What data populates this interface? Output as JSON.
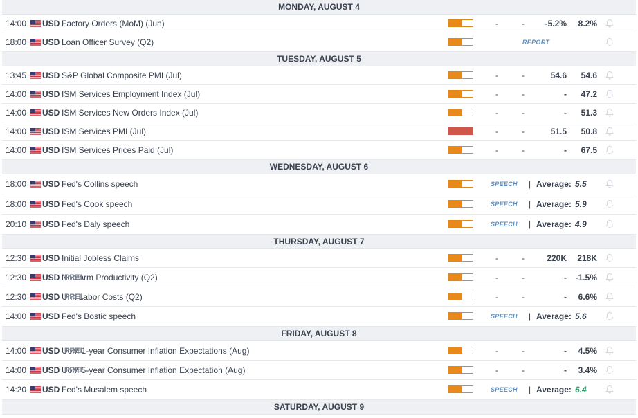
{
  "days": [
    {
      "label": "MONDAY, AUGUST 4",
      "events": [
        {
          "time": "14:00",
          "currency": "USD",
          "name": "Factory Orders (MoM) (Jun)",
          "prel": "",
          "importance": 0.55,
          "importance_color": "#e8891a",
          "kind": "data",
          "consensus": "-",
          "previous": "-5.2%",
          "actual": "8.2%",
          "forecast_dash": "-"
        },
        {
          "time": "18:00",
          "currency": "USD",
          "name": "Loan Officer Survey (Q2)",
          "prel": "",
          "importance": 0.55,
          "importance_color": "#e8891a",
          "kind": "report",
          "tag": "REPORT"
        }
      ]
    },
    {
      "label": "TUESDAY, AUGUST 5",
      "events": [
        {
          "time": "13:45",
          "currency": "USD",
          "name": "S&P Global Composite PMI (Jul)",
          "prel": "",
          "importance": 0.55,
          "importance_color": "#e8891a",
          "kind": "data",
          "consensus": "-",
          "previous": "54.6",
          "actual": "54.6",
          "forecast_dash": "-"
        },
        {
          "time": "14:00",
          "currency": "USD",
          "name": "ISM Services Employment Index (Jul)",
          "prel": "",
          "importance": 0.55,
          "importance_color": "#e8891a",
          "kind": "data",
          "consensus": "-",
          "previous": "-",
          "actual": "47.2",
          "forecast_dash": "-"
        },
        {
          "time": "14:00",
          "currency": "USD",
          "name": "ISM Services New Orders Index (Jul)",
          "prel": "",
          "importance": 0.55,
          "importance_color": "#e8891a",
          "kind": "data",
          "consensus": "-",
          "previous": "-",
          "actual": "51.3",
          "forecast_dash": "-"
        },
        {
          "time": "14:00",
          "currency": "USD",
          "name": "ISM Services PMI (Jul)",
          "prel": "",
          "importance": 1.0,
          "importance_color": "#d0564a",
          "kind": "data",
          "consensus": "-",
          "previous": "51.5",
          "actual": "50.8",
          "forecast_dash": "-",
          "high": true
        },
        {
          "time": "14:00",
          "currency": "USD",
          "name": "ISM Services Prices Paid (Jul)",
          "prel": "",
          "importance": 0.55,
          "importance_color": "#e8891a",
          "kind": "data",
          "consensus": "-",
          "previous": "-",
          "actual": "67.5",
          "forecast_dash": "-"
        }
      ]
    },
    {
      "label": "WEDNESDAY, AUGUST 6",
      "events": [
        {
          "time": "18:00",
          "currency": "USD",
          "name": "Fed's Collins speech",
          "prel": "",
          "importance": 0.55,
          "importance_color": "#e8891a",
          "kind": "speech",
          "tag": "SPEECH",
          "avg_label": "Average:",
          "avg_value": "5.5",
          "avg_color": "#3a4250"
        },
        {
          "time": "18:00",
          "currency": "USD",
          "name": "Fed's Cook speech",
          "prel": "",
          "importance": 0.55,
          "importance_color": "#e8891a",
          "kind": "speech",
          "tag": "SPEECH",
          "avg_label": "Average:",
          "avg_value": "5.9",
          "avg_color": "#3a4250"
        },
        {
          "time": "20:10",
          "currency": "USD",
          "name": "Fed's Daly speech",
          "prel": "",
          "importance": 0.55,
          "importance_color": "#e8891a",
          "kind": "speech",
          "tag": "SPEECH",
          "avg_label": "Average:",
          "avg_value": "4.9",
          "avg_color": "#3a4250"
        }
      ]
    },
    {
      "label": "THURSDAY, AUGUST 7",
      "events": [
        {
          "time": "12:30",
          "currency": "USD",
          "name": "Initial Jobless Claims",
          "prel": "",
          "importance": 0.55,
          "importance_color": "#e8891a",
          "kind": "data",
          "consensus": "-",
          "previous": "220K",
          "actual": "218K",
          "forecast_dash": "-"
        },
        {
          "time": "12:30",
          "currency": "USD",
          "name": "Nonfarm Productivity (Q2)",
          "prel": "PREL",
          "importance": 0.55,
          "importance_color": "#e8891a",
          "kind": "data",
          "consensus": "-",
          "previous": "-",
          "actual": "-1.5%",
          "forecast_dash": "-"
        },
        {
          "time": "12:30",
          "currency": "USD",
          "name": "Unit Labor Costs (Q2)",
          "prel": "PREL",
          "importance": 0.55,
          "importance_color": "#e8891a",
          "kind": "data",
          "consensus": "-",
          "previous": "-",
          "actual": "6.6%",
          "forecast_dash": "-"
        },
        {
          "time": "14:00",
          "currency": "USD",
          "name": "Fed's Bostic speech",
          "prel": "",
          "importance": 0.55,
          "importance_color": "#e8891a",
          "kind": "speech",
          "tag": "SPEECH",
          "avg_label": "Average:",
          "avg_value": "5.6",
          "avg_color": "#3a4250"
        }
      ]
    },
    {
      "label": "FRIDAY, AUGUST 8",
      "events": [
        {
          "time": "14:00",
          "currency": "USD",
          "name": "UoM 1-year Consumer Inflation Expectations (Aug)",
          "prel": "PREL",
          "importance": 0.55,
          "importance_color": "#e8891a",
          "kind": "data",
          "consensus": "-",
          "previous": "-",
          "actual": "4.5%",
          "forecast_dash": "-"
        },
        {
          "time": "14:00",
          "currency": "USD",
          "name": "UoM 5-year Consumer Inflation Expectation (Aug)",
          "prel": "PREL",
          "importance": 0.55,
          "importance_color": "#e8891a",
          "kind": "data",
          "consensus": "-",
          "previous": "-",
          "actual": "3.4%",
          "forecast_dash": "-"
        },
        {
          "time": "14:20",
          "currency": "USD",
          "name": "Fed's Musalem speech",
          "prel": "",
          "importance": 0.55,
          "importance_color": "#e8891a",
          "kind": "speech",
          "tag": "SPEECH",
          "avg_label": "Average:",
          "avg_value": "6.4",
          "avg_color": "#2e9a6a"
        }
      ]
    },
    {
      "label": "SATURDAY, AUGUST 9",
      "events": []
    }
  ],
  "icons": {
    "flag": "us-flag-icon",
    "bell": "bell-icon"
  }
}
